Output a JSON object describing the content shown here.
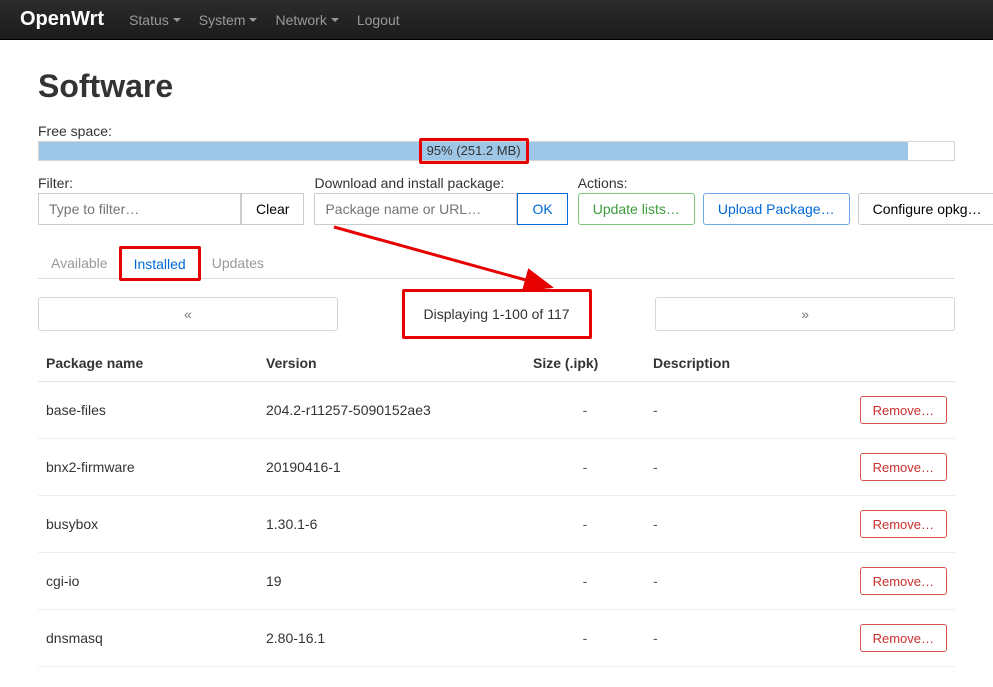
{
  "nav": {
    "brand": "OpenWrt",
    "items": [
      "Status",
      "System",
      "Network"
    ],
    "logout": "Logout"
  },
  "page": {
    "title": "Software",
    "free_space_label": "Free space:",
    "free_space_text": "95% (251.2 MB)",
    "free_space_pct": 95
  },
  "filter": {
    "label": "Filter:",
    "placeholder": "Type to filter…",
    "clear": "Clear"
  },
  "download": {
    "label": "Download and install package:",
    "placeholder": "Package name or URL…",
    "ok": "OK"
  },
  "actions": {
    "label": "Actions:",
    "update": "Update lists…",
    "upload": "Upload Package…",
    "configure": "Configure opkg…"
  },
  "tabs": {
    "available": "Available",
    "installed": "Installed",
    "updates": "Updates"
  },
  "pager": {
    "prev": "«",
    "text": "Displaying 1-100 of 117",
    "next": "»"
  },
  "table": {
    "headers": {
      "name": "Package name",
      "version": "Version",
      "size": "Size (.ipk)",
      "desc": "Description"
    },
    "remove_label": "Remove…",
    "rows": [
      {
        "name": "base-files",
        "version": "204.2-r11257-5090152ae3",
        "size": "-",
        "desc": "-"
      },
      {
        "name": "bnx2-firmware",
        "version": "20190416-1",
        "size": "-",
        "desc": "-"
      },
      {
        "name": "busybox",
        "version": "1.30.1-6",
        "size": "-",
        "desc": "-"
      },
      {
        "name": "cgi-io",
        "version": "19",
        "size": "-",
        "desc": "-"
      },
      {
        "name": "dnsmasq",
        "version": "2.80-16.1",
        "size": "-",
        "desc": "-"
      }
    ]
  }
}
